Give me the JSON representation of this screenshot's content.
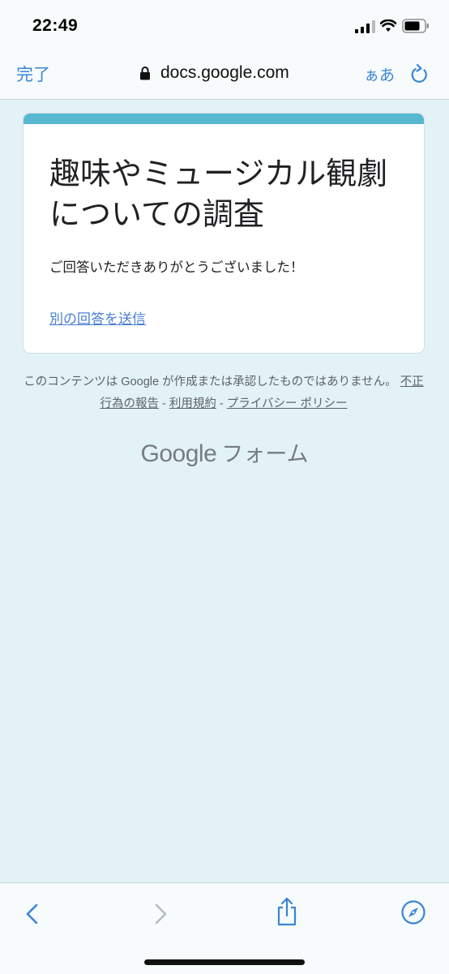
{
  "status_bar": {
    "time": "22:49"
  },
  "browser": {
    "done_label": "完了",
    "url": "docs.google.com",
    "text_size_label": "ぁあ",
    "icons": {
      "lock": "lock-icon",
      "reload": "reload-icon",
      "back": "chevron-left-icon",
      "forward": "chevron-right-icon",
      "share": "share-icon",
      "compass": "compass-icon"
    }
  },
  "form": {
    "title": "趣味やミュージカル観劇についての調査",
    "confirmation": "ご回答いただきありがとうございました！",
    "another_response_link": "別の回答を送信"
  },
  "disclaimer": {
    "text": "このコンテンツは Google が作成または承認したものではありません。",
    "report_abuse": "不正行為の報告",
    "terms": "利用規約",
    "privacy": "プライバシー ポリシー",
    "separator": " - "
  },
  "logo": {
    "google": "Google",
    "forms": "フォーム"
  },
  "colors": {
    "accent": "#57b8d0",
    "background": "#e2f2f7",
    "ios_blue": "#3a85d8",
    "link": "#4a7fd4"
  }
}
